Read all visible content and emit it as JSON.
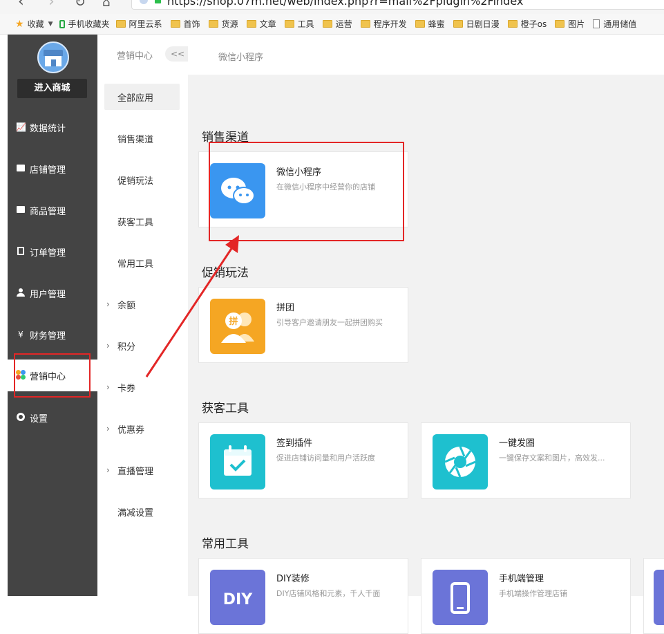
{
  "browser": {
    "url": "https://shop.07m.net/web/index.php?r=mall%2Fplugin%2Findex",
    "bookmarks": [
      {
        "label": "收藏",
        "icon": "star-icon"
      },
      {
        "label": "手机收藏夹",
        "icon": "phone-icon"
      },
      {
        "label": "阿里云系",
        "icon": "folder-icon"
      },
      {
        "label": "首饰",
        "icon": "folder-icon"
      },
      {
        "label": "货源",
        "icon": "folder-icon"
      },
      {
        "label": "文章",
        "icon": "folder-icon"
      },
      {
        "label": "工具",
        "icon": "folder-icon"
      },
      {
        "label": "运营",
        "icon": "folder-icon"
      },
      {
        "label": "程序开发",
        "icon": "folder-icon"
      },
      {
        "label": "蜂蜜",
        "icon": "folder-icon"
      },
      {
        "label": "日剧日漫",
        "icon": "folder-icon"
      },
      {
        "label": "橙子os",
        "icon": "folder-icon"
      },
      {
        "label": "图片",
        "icon": "folder-icon"
      },
      {
        "label": "通用储值",
        "icon": "doc-icon"
      }
    ]
  },
  "sidebar": {
    "enter_mall": "进入商城",
    "items": [
      {
        "label": "数据统计",
        "icon": "chart-icon",
        "active": false
      },
      {
        "label": "店铺管理",
        "icon": "store-icon",
        "active": false
      },
      {
        "label": "商品管理",
        "icon": "goods-icon",
        "active": false
      },
      {
        "label": "订单管理",
        "icon": "order-icon",
        "active": false
      },
      {
        "label": "用户管理",
        "icon": "user-icon",
        "active": false
      },
      {
        "label": "财务管理",
        "icon": "finance-icon",
        "active": false
      },
      {
        "label": "营销中心",
        "icon": "marketing-icon",
        "active": true
      },
      {
        "label": "设置",
        "icon": "settings-icon",
        "active": false
      }
    ]
  },
  "submenu": {
    "title": "营销中心",
    "collapse": "<<",
    "items": [
      {
        "label": "全部应用",
        "active": true,
        "expandable": false
      },
      {
        "label": "销售渠道",
        "active": false,
        "expandable": false
      },
      {
        "label": "促销玩法",
        "active": false,
        "expandable": false
      },
      {
        "label": "获客工具",
        "active": false,
        "expandable": false
      },
      {
        "label": "常用工具",
        "active": false,
        "expandable": false
      },
      {
        "label": "余额",
        "active": false,
        "expandable": true
      },
      {
        "label": "积分",
        "active": false,
        "expandable": true
      },
      {
        "label": "卡券",
        "active": false,
        "expandable": true
      },
      {
        "label": "优惠券",
        "active": false,
        "expandable": true
      },
      {
        "label": "直播管理",
        "active": false,
        "expandable": true
      },
      {
        "label": "满减设置",
        "active": false,
        "expandable": false
      }
    ]
  },
  "header": {
    "title": "微信小程序"
  },
  "sections": [
    {
      "title": "销售渠道",
      "cards": [
        {
          "name": "微信小程序",
          "desc": "在微信小程序中经营你的店铺",
          "icon": "wechat-icon",
          "color": "#3a96f0"
        }
      ]
    },
    {
      "title": "促销玩法",
      "cards": [
        {
          "name": "拼团",
          "desc": "引导客户邀请朋友一起拼团购买",
          "icon": "group-buy-icon",
          "color": "#f5a623",
          "badge": "拼"
        }
      ]
    },
    {
      "title": "获客工具",
      "cards": [
        {
          "name": "签到插件",
          "desc": "促进店铺访问量和用户活跃度",
          "icon": "calendar-check-icon",
          "color": "#1ec0cf"
        },
        {
          "name": "一键发圈",
          "desc": "一键保存文案和图片，高效发...",
          "icon": "aperture-icon",
          "color": "#1ec0cf"
        }
      ]
    },
    {
      "title": "常用工具",
      "cards": [
        {
          "name": "DIY装修",
          "desc": "DIY店铺风格和元素，千人千面",
          "icon": "diy-icon",
          "color": "#6b74d8",
          "badge": "DIY"
        },
        {
          "name": "手机端管理",
          "desc": "手机端操作管理店铺",
          "icon": "mobile-icon",
          "color": "#6b74d8"
        }
      ]
    }
  ],
  "colors": {
    "sidebar_bg": "#444444",
    "content_bg": "#f2f2f2",
    "annotation_red": "#e32626"
  }
}
